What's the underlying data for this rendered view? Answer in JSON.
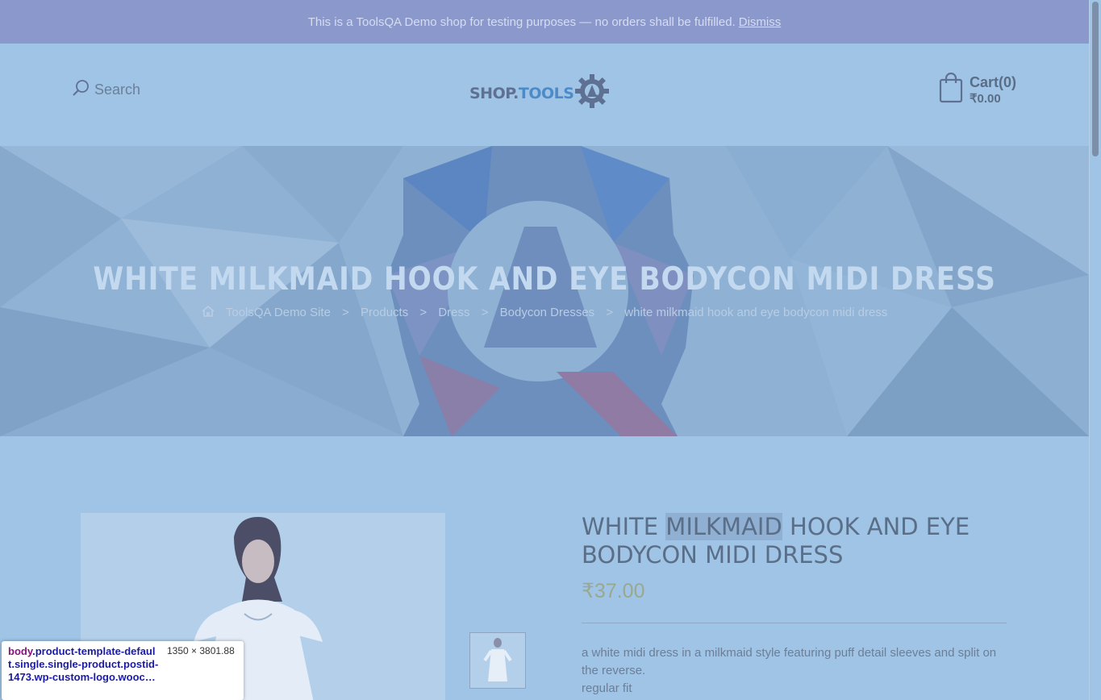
{
  "notice": {
    "text": "This is a ToolsQA Demo shop for testing purposes — no orders shall be fulfilled.",
    "dismiss": "Dismiss"
  },
  "header": {
    "search_label": "Search",
    "logo_part1": "SHOP.",
    "logo_part2": "TOOLS",
    "cart_label": "Cart(0)",
    "cart_total": "₹0.00"
  },
  "hero": {
    "title": "WHITE MILKMAID HOOK AND EYE BODYCON MIDI DRESS",
    "breadcrumbs": [
      "ToolsQA Demo Site",
      "Products",
      "Dress",
      "Bodycon Dresses",
      "white milkmaid hook and eye bodycon midi dress"
    ],
    "separator": ">"
  },
  "product": {
    "title_before": "WHITE ",
    "title_highlight": "MILKMAID",
    "title_after": " HOOK AND EYE BODYCON MIDI DRESS",
    "price": "₹37.00",
    "desc_line1": "a white midi dress in a milkmaid style featuring puff detail sleeves and split on the reverse.",
    "desc_line2": "regular fit"
  },
  "devtools": {
    "tag": "body",
    "classes": ".product-template-default.single.single-product.postid-1473.wp-custom-logo.wooc…",
    "dimensions": "1350 × 3801.88"
  },
  "colors": {
    "overlay": "#9fc4e6",
    "notice_bg": "#8a98cc",
    "price": "#9aa890"
  }
}
